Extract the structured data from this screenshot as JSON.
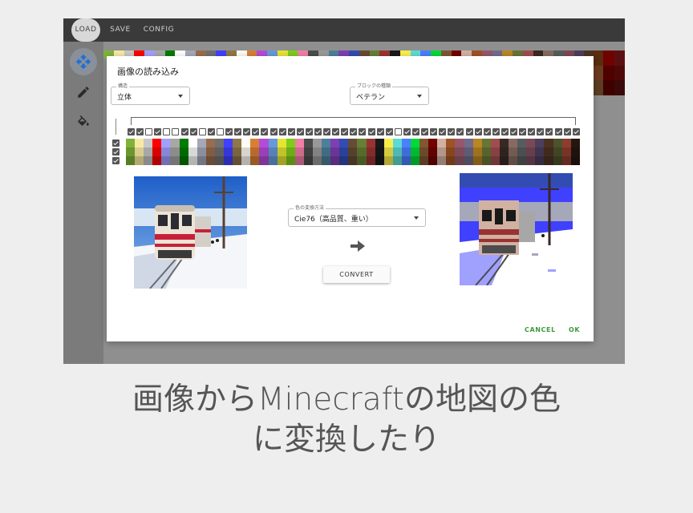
{
  "menu": {
    "load_label": "LOAD",
    "save_label": "SAVE",
    "config_label": "CONFIG"
  },
  "toolbar": {
    "tools": [
      {
        "name": "move",
        "icon": "move-icon",
        "active": true
      },
      {
        "name": "pencil",
        "icon": "pencil-icon",
        "active": false
      },
      {
        "name": "fill",
        "icon": "paint-bucket-icon",
        "active": false
      }
    ]
  },
  "dialog": {
    "title": "画像の読み込み",
    "shape_select": {
      "label": "構造",
      "value": "立体"
    },
    "block_select": {
      "label": "ブロックの種類",
      "value": "ベテラン"
    },
    "method_select": {
      "label": "色の変換方法",
      "value": "Cie76（高品質、重い）"
    },
    "convert_label": "CONVERT",
    "cancel_label": "CANCEL",
    "ok_label": "OK",
    "left_checks": [
      true,
      true,
      true
    ],
    "column_checks": [
      true,
      true,
      false,
      true,
      false,
      false,
      true,
      true,
      false,
      true,
      false,
      true,
      true,
      true,
      true,
      true,
      true,
      true,
      true,
      true,
      true,
      true,
      true,
      true,
      true,
      true,
      true,
      true,
      true,
      true,
      false,
      true,
      true,
      true,
      true,
      true,
      true,
      true,
      true,
      true,
      true,
      true,
      true,
      true,
      true,
      true,
      true,
      true,
      true,
      true,
      true
    ],
    "palette": [
      [
        "#7fb238",
        "#6b972e",
        "#597d26"
      ],
      [
        "#f7e9a3",
        "#d9cc8c",
        "#b5a972"
      ],
      [
        "#c7c7c7",
        "#a7a7a7",
        "#8a8a8a"
      ],
      [
        "#ff0000",
        "#d80000",
        "#b40000"
      ],
      [
        "#a0a0ff",
        "#8787d8",
        "#7070b4"
      ],
      [
        "#a7a7a7",
        "#8c8c8c",
        "#757575"
      ],
      [
        "#007c00",
        "#006a00",
        "#005700"
      ],
      [
        "#ffffff",
        "#d8d8d8",
        "#b4b4b4"
      ],
      [
        "#a4a8b8",
        "#8b8e9c",
        "#737682"
      ],
      [
        "#976d4d",
        "#805c41",
        "#6a4c36"
      ],
      [
        "#707070",
        "#5f5f5f",
        "#4f4f4f"
      ],
      [
        "#4040ff",
        "#3636d8",
        "#2d2db4"
      ],
      [
        "#8f7748",
        "#79653d",
        "#654f33"
      ],
      [
        "#fffcf5",
        "#d8d5cf",
        "#b4b2ad"
      ],
      [
        "#d87f33",
        "#b76b2b",
        "#985924"
      ],
      [
        "#b24cd8",
        "#9740b7",
        "#7e3598"
      ],
      [
        "#6699d8",
        "#5682b7",
        "#487198"
      ],
      [
        "#e5e533",
        "#c2c22b",
        "#a2a224"
      ],
      [
        "#7fcc19",
        "#6bad15",
        "#5a9012"
      ],
      [
        "#f27fa5",
        "#cd6b8c",
        "#ab5974"
      ],
      [
        "#4c4c4c",
        "#404040",
        "#363636"
      ],
      [
        "#999999",
        "#828282",
        "#6c6c6c"
      ],
      [
        "#4c7f99",
        "#406b82",
        "#365a6c"
      ],
      [
        "#7f3fb2",
        "#6b3597",
        "#5a2c7e"
      ],
      [
        "#334cb2",
        "#2b4097",
        "#24357e"
      ],
      [
        "#664c33",
        "#56402b",
        "#483524"
      ],
      [
        "#667f33",
        "#566b2b",
        "#485a24"
      ],
      [
        "#993333",
        "#822b2b",
        "#6c2424"
      ],
      [
        "#191919",
        "#151515",
        "#121212"
      ],
      [
        "#faee4d",
        "#d4ca41",
        "#b1a836"
      ],
      [
        "#5cdbd5",
        "#4eb9b4",
        "#419b97"
      ],
      [
        "#4a80ff",
        "#3f6cd8",
        "#345ab4"
      ],
      [
        "#00d93a",
        "#00b831",
        "#009a29"
      ],
      [
        "#815631",
        "#6d492a",
        "#5b3d23"
      ],
      [
        "#700200",
        "#5f0100",
        "#4f0100"
      ],
      [
        "#d1b1a1",
        "#b19689",
        "#947d72"
      ],
      [
        "#9f5224",
        "#87451e",
        "#713a19"
      ],
      [
        "#95576c",
        "#7e4a5b",
        "#69404c"
      ],
      [
        "#706c8a",
        "#5f5b75",
        "#4f4c62"
      ],
      [
        "#ba8524",
        "#9e711e",
        "#845e19"
      ],
      [
        "#677535",
        "#57632d",
        "#495326"
      ],
      [
        "#a04d4e",
        "#884142",
        "#713637"
      ],
      [
        "#392923",
        "#30231e",
        "#281d19"
      ],
      [
        "#876b62",
        "#725b53",
        "#5f4c45"
      ],
      [
        "#575c5c",
        "#4a4e4e",
        "#3e4141"
      ],
      [
        "#7a4958",
        "#673e4b",
        "#563340"
      ],
      [
        "#4c3e5c",
        "#40344e",
        "#362b41"
      ],
      [
        "#4c3223",
        "#402a1e",
        "#362319"
      ],
      [
        "#4c522a",
        "#404623",
        "#363a1d"
      ],
      [
        "#8e3c2e",
        "#783327",
        "#652a21"
      ],
      [
        "#251610",
        "#1f120d",
        "#1a0f0b"
      ]
    ],
    "strip_colors": [
      "#7fb238",
      "#f7e9a3",
      "#c7c7c7",
      "#ff0000",
      "#a0a0ff",
      "#a7a7a7",
      "#007c00",
      "#ffffff",
      "#a4a8b8",
      "#976d4d",
      "#707070",
      "#4040ff",
      "#8f7748",
      "#fffcf5",
      "#d87f33",
      "#b24cd8",
      "#6699d8",
      "#e5e533",
      "#7fcc19",
      "#f27fa5",
      "#4c4c4c",
      "#999999",
      "#4c7f99",
      "#7f3fb2",
      "#334cb2",
      "#664c33",
      "#667f33",
      "#993333",
      "#191919",
      "#faee4d",
      "#5cdbd5",
      "#4a80ff",
      "#00d93a",
      "#815631",
      "#700200",
      "#d1b1a1",
      "#9f5224",
      "#95576c",
      "#706c8a",
      "#ba8524",
      "#677535",
      "#a04d4e",
      "#392923",
      "#876b62",
      "#575c5c",
      "#7a4958",
      "#4c3e5c",
      "#4c3223",
      "#4c522a",
      "#8e3c2e",
      "#251610"
    ],
    "bg_right_colors": [
      "#5a2c10",
      "#700200",
      "#5a1010",
      "#6a3a20",
      "#4f0100",
      "#4f0808",
      "#5b3d23",
      "#400000",
      "#3a0a0a"
    ]
  },
  "caption": {
    "line1": "画像からMinecraftの地図の色",
    "line2": "に変換したり"
  },
  "colors": {
    "accent_green": "#3d9a3d",
    "topbar": "#3a3a3a",
    "page_bg": "#eeeeee"
  }
}
